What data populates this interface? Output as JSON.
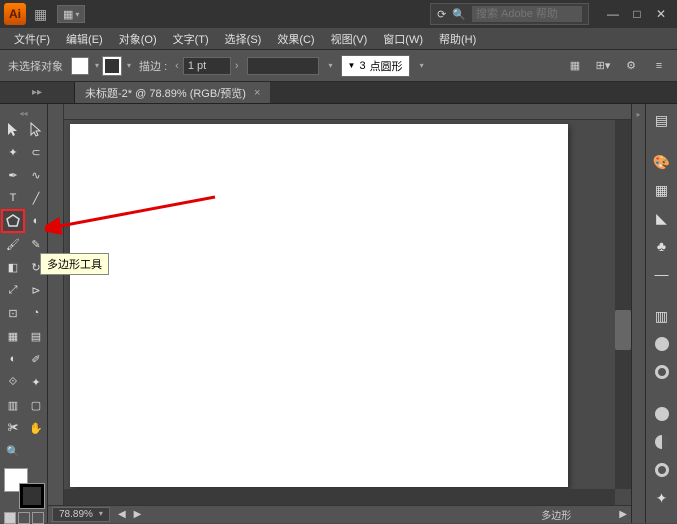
{
  "titlebar": {
    "logo": "Ai",
    "search_placeholder": "搜索 Adobe 帮助"
  },
  "menu": {
    "file": "文件(F)",
    "edit": "编辑(E)",
    "object": "对象(O)",
    "type": "文字(T)",
    "select": "选择(S)",
    "effect": "效果(C)",
    "view": "视图(V)",
    "window": "窗口(W)",
    "help": "帮助(H)"
  },
  "control": {
    "no_selection": "未选择对象",
    "stroke_label": "描边 :",
    "stroke_width": "1 pt",
    "style_value": "",
    "opacity_value": "3",
    "brush_label": "点圆形"
  },
  "doc": {
    "tab_title": "未标题-2* @ 78.89% (RGB/预览)",
    "expand_chars": "▸▸"
  },
  "tools": {
    "tooltip_text": "多边形工具"
  },
  "status": {
    "zoom": "78.89%",
    "current_tool": "多边形"
  }
}
